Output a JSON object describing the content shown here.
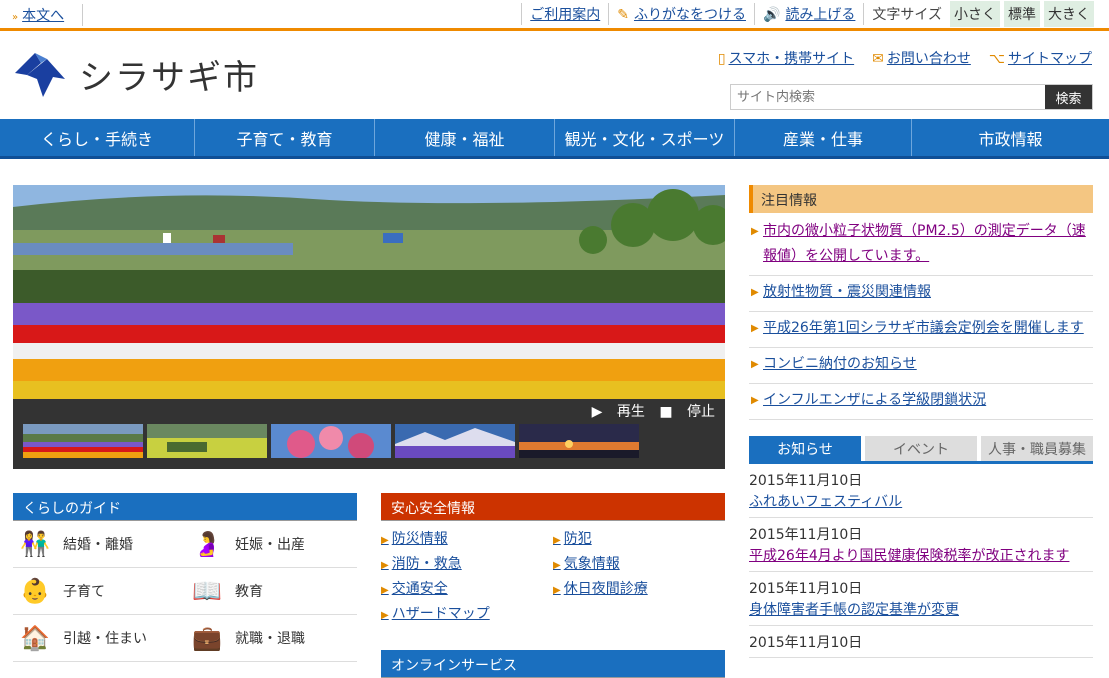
{
  "topbar": {
    "skip_link": "本文へ",
    "guide": "ご利用案内",
    "furigana": "ふりがなをつける",
    "readaloud": "読み上げる",
    "fontsize_label": "文字サイズ",
    "font_small": "小さく",
    "font_standard": "標準",
    "font_large": "大きく"
  },
  "header": {
    "site_title": "シラサギ市",
    "links": [
      "スマホ・携帯サイト",
      "お問い合わせ",
      "サイトマップ"
    ],
    "search_placeholder": "サイト内検索",
    "search_button": "検索"
  },
  "gnav": [
    "くらし・手続き",
    "子育て・教育",
    "健康・福祉",
    "観光・文化・スポーツ",
    "産業・仕事",
    "市政情報"
  ],
  "slideshow": {
    "play": "再生",
    "stop": "停止"
  },
  "guide": {
    "title": "くらしのガイド",
    "items": [
      {
        "label": "結婚・離婚",
        "icon": "couple-icon"
      },
      {
        "label": "妊娠・出産",
        "icon": "pregnancy-icon"
      },
      {
        "label": "子育て",
        "icon": "baby-icon"
      },
      {
        "label": "教育",
        "icon": "book-icon"
      },
      {
        "label": "引越・住まい",
        "icon": "house-icon"
      },
      {
        "label": "就職・退職",
        "icon": "briefcase-icon"
      }
    ]
  },
  "safety": {
    "title": "安心安全情報",
    "items": [
      "防災情報",
      "防犯",
      "消防・救急",
      "気象情報",
      "交通安全",
      "休日夜間診療",
      "ハザードマップ"
    ]
  },
  "online": {
    "title": "オンラインサービス"
  },
  "pickup": {
    "title": "注目情報",
    "items": [
      "市内の微小粒子状物質（PM2.5）の測定データ（速報値）を公開しています。",
      "放射性物質・震災関連情報",
      "平成26年第1回シラサギ市議会定例会を開催します",
      "コンビニ納付のお知らせ",
      "インフルエンザによる学級閉鎖状況"
    ]
  },
  "tabs": [
    "お知らせ",
    "イベント",
    "人事・職員募集"
  ],
  "news": [
    {
      "date": "2015年11月10日",
      "title": "ふれあいフェスティバル"
    },
    {
      "date": "2015年11月10日",
      "title": "平成26年4月より国民健康保険税率が改正されます"
    },
    {
      "date": "2015年11月10日",
      "title": "身体障害者手帳の認定基準が変更"
    },
    {
      "date": "2015年11月10日",
      "title": ""
    }
  ],
  "colors": {
    "accent_orange": "#ef8a00",
    "nav_blue": "#1a6fbf",
    "safety_red": "#cc3300"
  }
}
